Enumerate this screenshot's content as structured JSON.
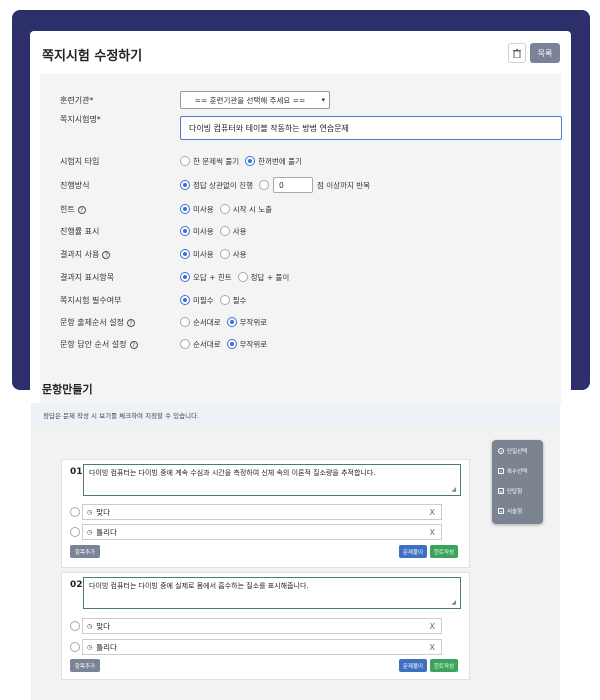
{
  "header": {
    "title": "쪽지시험 수정하기",
    "list_button": "목록",
    "trash_icon": "trash-icon"
  },
  "form": {
    "org_label": "훈련기관*",
    "org_select": "== 훈련기관을 선택해 주세요 ==",
    "name_label": "쪽지시험명*",
    "name_value": "다이빙 컴퓨터와 테이블 작동하는 방법 연습문제",
    "type_label": "시험지 타입",
    "type_opt1": "한 문제씩 풀기",
    "type_opt2": "한꺼번에 풀기",
    "mode_label": "진행방식",
    "mode_opt1": "정답 상관없이 진행",
    "mode_number": "0",
    "mode_suffix": "점 이상까지 반복",
    "hint_label": "힌트",
    "hint_opt1": "미사용",
    "hint_opt2": "시작 시 노출",
    "progress_label": "진행률 표시",
    "progress_opt1": "미사용",
    "progress_opt2": "사용",
    "result_label": "결과지 사용",
    "result_opt1": "미사용",
    "result_opt2": "사용",
    "result_items_label": "결과지 표시항목",
    "result_items_opt1": "오답 + 힌트",
    "result_items_opt2": "정답 + 풀이",
    "required_label": "쪽지시험 필수여부",
    "required_opt1": "미필수",
    "required_opt2": "필수",
    "order_label": "문항 출제순서 설정",
    "order_opt1": "순서대로",
    "order_opt2": "무작위로",
    "answer_order_label": "문항 답안 순서 설정",
    "answer_order_opt1": "순서대로",
    "answer_order_opt2": "무작위로",
    "help_mark": "?"
  },
  "questions_section": {
    "title": "문항만들기",
    "notice": "정답은 문제 작성 시 보기를 체크하여 지정할 수 있습니다.",
    "add_button": "항목추가",
    "solve_button": "문제풀이",
    "hint_button": "힌트작성",
    "remove_mark": "X",
    "questions": [
      {
        "number": "01.",
        "text": "다이빙 컴퓨터는 다이빙 중에 계속 수심과 시간을 측정하여 신체 속의 이론적 질소량을 추적합니다.",
        "answers": [
          "맞다",
          "틀리다"
        ]
      },
      {
        "number": "02.",
        "text": "다이빙 컴퓨터는 다이빙 중에 실제로 몸에서 흡수하는 질소를 표시해줍니다.",
        "answers": [
          "맞다",
          "틀리다"
        ]
      }
    ]
  },
  "side_menu": {
    "items": [
      "단일선택",
      "복수선택",
      "단답형",
      "서술형"
    ]
  },
  "colors": {
    "frame": "#2d2f6b",
    "accent": "#3b6fd4",
    "hint_green": "#3ba45c",
    "gray_button": "#7a8397"
  }
}
